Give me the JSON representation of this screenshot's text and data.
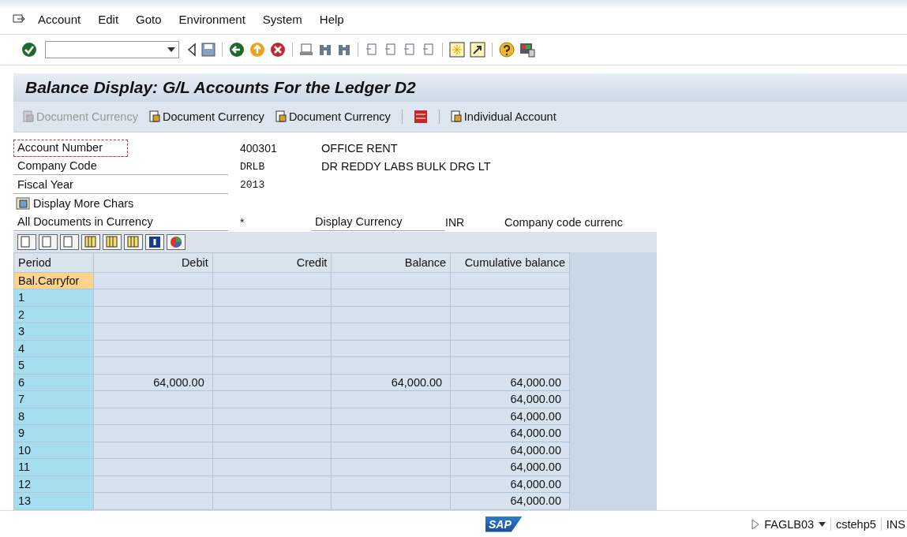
{
  "menu": [
    {
      "label": "Account"
    },
    {
      "label": "Edit"
    },
    {
      "label": "Goto"
    },
    {
      "label": "Environment"
    },
    {
      "label": "System"
    },
    {
      "label": "Help"
    }
  ],
  "title": "Balance Display: G/L Accounts For the Ledger D2",
  "app_toolbar": [
    {
      "kind": "button",
      "label": "Document Currency",
      "disabled": true
    },
    {
      "kind": "button",
      "label": "Document Currency",
      "disabled": false
    },
    {
      "kind": "button",
      "label": "Document Currency",
      "disabled": false
    },
    {
      "kind": "icon",
      "disabled": false
    },
    {
      "kind": "button",
      "label": "Individual Account",
      "disabled": false
    }
  ],
  "fields": [
    {
      "label": "Account Number",
      "value": "400301",
      "description": "OFFICE RENT",
      "selected": true
    },
    {
      "label": "Company Code",
      "value": "DRLB",
      "description": "DR REDDY LABS BULK DRG LT",
      "selected": false
    },
    {
      "label": "Fiscal Year",
      "value": "2013",
      "selected": false
    }
  ],
  "more_button": "Display More Chars",
  "currency_row": {
    "label": "All Documents in Currency",
    "value": "*",
    "label2": "Display Currency",
    "value2": "INR",
    "description": "Company code currenc"
  },
  "table": {
    "columns": [
      "Period",
      "Debit",
      "Credit",
      "Balance",
      "Cumulative balance"
    ],
    "rows": [
      {
        "cells": [
          "Bal.Carryfor",
          "",
          " ",
          "",
          ""
        ],
        "selected": true
      },
      {
        "cells": [
          "1",
          "",
          "",
          "",
          ""
        ],
        "selected": false
      },
      {
        "cells": [
          "2",
          "",
          "",
          "",
          ""
        ],
        "selected": false
      },
      {
        "cells": [
          "3",
          "",
          "",
          "",
          ""
        ],
        "selected": false
      },
      {
        "cells": [
          "4",
          "",
          "",
          "",
          ""
        ],
        "selected": false
      },
      {
        "cells": [
          "5",
          "",
          "",
          "",
          ""
        ],
        "selected": false
      },
      {
        "cells": [
          "6",
          "64,000.00",
          "",
          "64,000.00",
          "64,000.00"
        ],
        "selected": false
      },
      {
        "cells": [
          "7",
          "",
          "",
          "",
          "64,000.00"
        ],
        "selected": false
      },
      {
        "cells": [
          "8",
          "",
          "",
          "",
          "64,000.00"
        ],
        "selected": false
      },
      {
        "cells": [
          "9",
          "",
          "",
          "",
          "64,000.00"
        ],
        "selected": false
      },
      {
        "cells": [
          "10",
          "",
          "",
          "",
          "64,000.00"
        ],
        "selected": false
      },
      {
        "cells": [
          "11",
          "",
          "",
          "",
          "64,000.00"
        ],
        "selected": false
      },
      {
        "cells": [
          "12",
          "",
          "",
          "",
          "64,000.00"
        ],
        "selected": false
      },
      {
        "cells": [
          "13",
          "",
          "",
          "",
          "64,000.00"
        ],
        "selected": false
      }
    ]
  },
  "status_bar": {
    "logo": "SAP",
    "transaction": "FAGLB03",
    "server": "cstehp5",
    "mode": "INS"
  }
}
